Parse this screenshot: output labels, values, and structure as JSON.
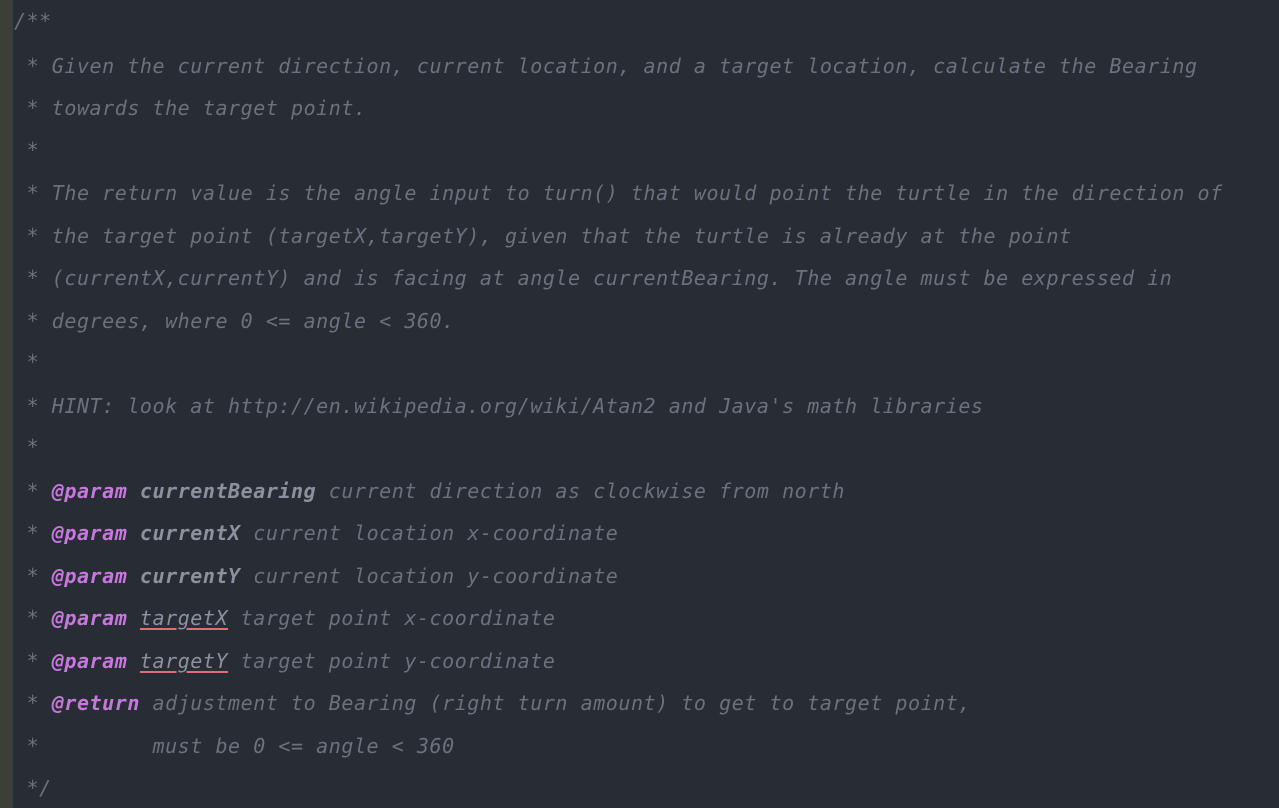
{
  "editor": {
    "lines": [
      {
        "text": "/**"
      },
      {
        "text": " * Given the current direction, current location, and a target location, calculate the Bearing"
      },
      {
        "text": " * towards the target point."
      },
      {
        "text": " *"
      },
      {
        "text": " * The return value is the angle input to turn() that would point the turtle in the direction of"
      },
      {
        "text": " * the target point (targetX,targetY), given that the turtle is already at the point"
      },
      {
        "text": " * (currentX,currentY) and is facing at angle currentBearing. The angle must be expressed in"
      },
      {
        "text": " * degrees, where 0 <= angle < 360."
      },
      {
        "text": " *"
      },
      {
        "text": " * HINT: look at http://en.wikipedia.org/wiki/Atan2 and Java's math libraries"
      },
      {
        "text": " *"
      },
      {
        "prefix": " * ",
        "tag": "@param",
        "name": "currentBearing",
        "desc": " current direction as clockwise from north"
      },
      {
        "prefix": " * ",
        "tag": "@param",
        "name": "currentX",
        "desc": " current location x-coordinate"
      },
      {
        "prefix": " * ",
        "tag": "@param",
        "name": "currentY",
        "desc": " current location y-coordinate"
      },
      {
        "prefix": " * ",
        "tag": "@param",
        "name": "targetX",
        "desc": " target point x-coordinate"
      },
      {
        "prefix": " * ",
        "tag": "@param",
        "name": "targetY",
        "desc": " target point y-coordinate"
      },
      {
        "prefix": " * ",
        "tag": "@return",
        "desc": " adjustment to Bearing (right turn amount) to get to target point,"
      },
      {
        "text": " *         must be 0 <= angle < 360"
      },
      {
        "text": " */"
      }
    ]
  }
}
